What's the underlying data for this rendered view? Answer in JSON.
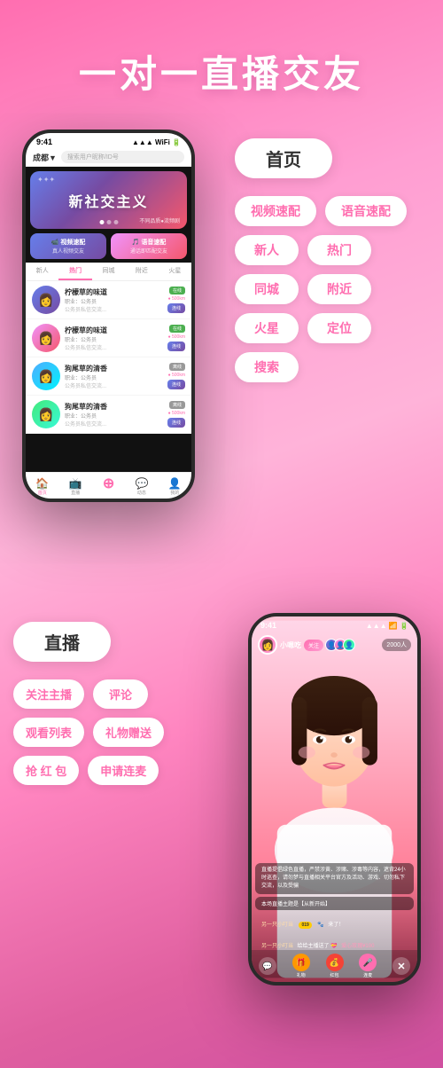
{
  "title": "一对一直播交友",
  "home_section": {
    "badge": "首页",
    "features": [
      "视频速配",
      "语音速配",
      "新人",
      "热门",
      "同城",
      "附近",
      "火星",
      "定位",
      "搜索"
    ]
  },
  "live_section": {
    "badge": "直播",
    "features": [
      "关注主播",
      "评论",
      "观看列表",
      "礼物赠送",
      "抢 红 包",
      "申请连麦"
    ]
  },
  "phone1": {
    "status_time": "9:41",
    "location": "成都▼",
    "search_placeholder": "搜索用户昵称/ID号",
    "banner_text": "新社交主义",
    "banner_sub": "不同品质●流频剧",
    "quick_video": "📹 视频速配",
    "quick_video_sub": "真人视频交友",
    "quick_audio": "🎵 语音速配",
    "quick_audio_sub": "通话即匹配交友",
    "tabs": [
      "新人",
      "热门",
      "同城",
      "附近",
      "火星"
    ],
    "active_tab": "热门",
    "users": [
      {
        "name": "柠檬草的味道",
        "tag": "在线",
        "job": "职业：公务员",
        "desc": "公务员私信交流...",
        "distance": "●500km"
      },
      {
        "name": "柠檬草的味道",
        "tag": "在线",
        "job": "职业：公务员",
        "desc": "公务员私信交流...",
        "distance": "●500km"
      },
      {
        "name": "狗尾草的清香",
        "tag": "离线",
        "job": "职业：公务员",
        "desc": "公务员私信交流...",
        "distance": "●500km"
      },
      {
        "name": "狗尾草的清香",
        "tag": "离线",
        "job": "职业：公务员",
        "desc": "公务员私信交流...",
        "distance": "●500km"
      }
    ],
    "bottom_nav": [
      "首页",
      "直播",
      "○",
      "动态",
      "我的"
    ]
  },
  "phone2": {
    "status_time": "9:41",
    "username": "小嗯吃",
    "follow_label": "关注",
    "viewer_count": "2000人",
    "chat": [
      "直播提倡绿色直播，严禁涉黄、涉赌、涉毒等内容，遮背24小时巡查，请勿梦与直播相关平台官方及活动、游戏、切勿私下交流，以及受骗",
      "本场直播主题是【从新开始】",
      "另一只小叮当 019 🐾 来了！",
      "另一只小叮当 给给主播送了 💝 爱心玫瑰¥100"
    ],
    "bottom_icons": [
      "💬",
      "🎁",
      "💰",
      "🎤",
      "✕"
    ]
  }
}
